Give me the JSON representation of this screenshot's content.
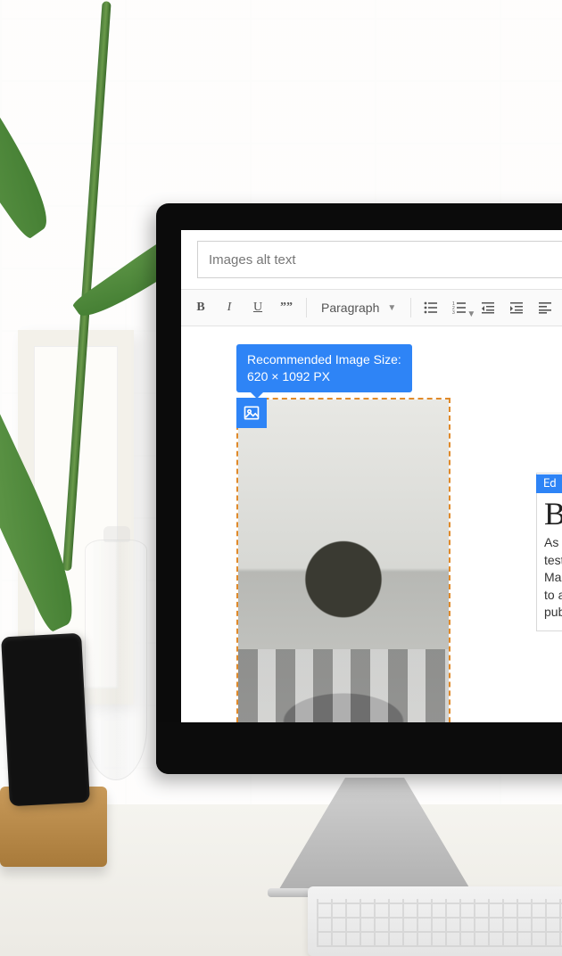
{
  "editor": {
    "alt_text_placeholder": "Images alt text",
    "toolbar": {
      "format_select": "Paragraph"
    },
    "tooltip": {
      "line1": "Recommended Image Size:",
      "line2": "620 × 1092 PX"
    },
    "side_panel": {
      "badge": "Ed",
      "heading": "B",
      "body_lines": [
        "As a",
        "test",
        "Ma",
        "to a",
        "pub"
      ]
    }
  }
}
